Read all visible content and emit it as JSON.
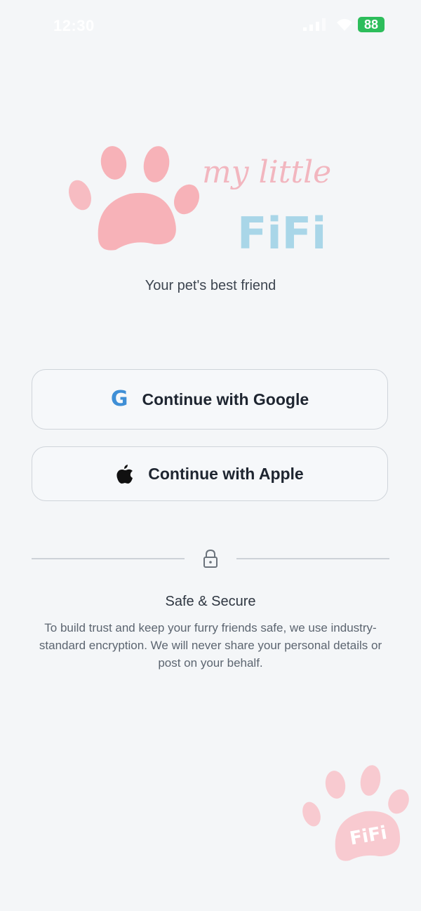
{
  "status_bar": {
    "time": "12:30",
    "battery": "88"
  },
  "logo": {
    "line1": "my little",
    "line2": "FiFi",
    "paw_color": "#f7b2b8",
    "line1_color": "#f2b6bf",
    "line2_color": "#a9d6e8"
  },
  "tagline": "Your pet's best friend",
  "auth": {
    "google_label": "Continue with Google",
    "google_icon": "G",
    "apple_label": "Continue with Apple"
  },
  "secure": {
    "title": "Safe & Secure",
    "text": "To build trust and keep your furry friends safe, we use industry-standard encryption. We will never share your personal details or post on your behalf."
  },
  "corner_badge": {
    "text": "FiFi"
  }
}
